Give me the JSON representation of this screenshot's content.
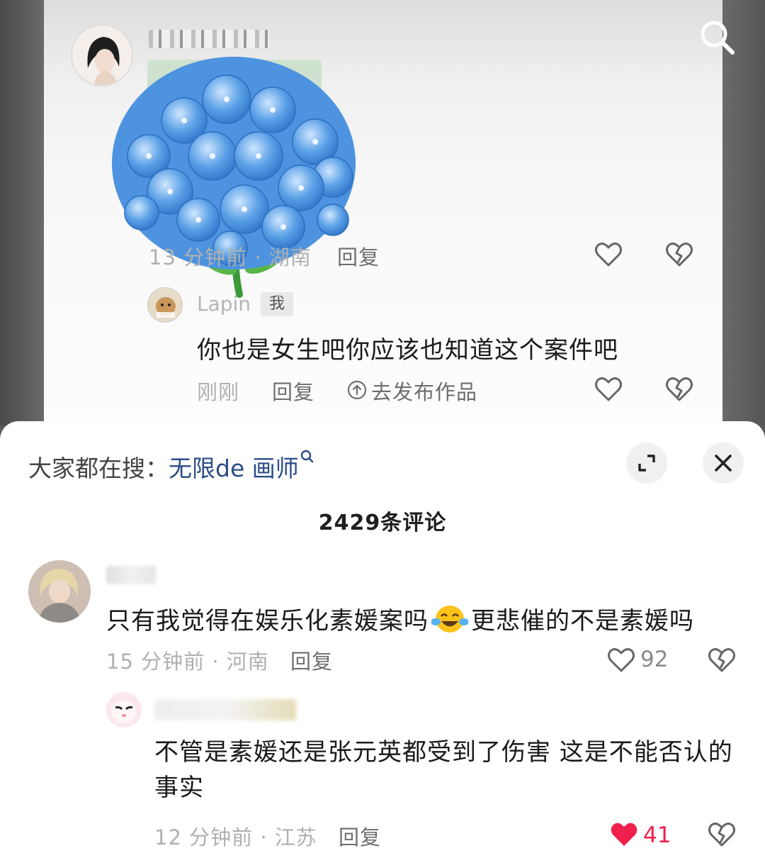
{
  "top_comment": {
    "time_location": "13 分钟前 · 湖南",
    "reply_label": "回复"
  },
  "my_reply": {
    "username": "Lapin",
    "badge": "我",
    "text": "你也是女生吧你应该也知道这个案件吧",
    "time": "刚刚",
    "reply_label": "回复",
    "publish_label": "去发布作品"
  },
  "sheet": {
    "hot_search_prefix": "大家都在搜：",
    "hot_search_keyword": "无限de 画师",
    "comment_count": "2429条评论"
  },
  "comment1": {
    "text_before_emoji": "只有我觉得在娱乐化素媛案吗",
    "emoji": "tears-of-joy-emoji",
    "text_after_emoji": "更悲催的不是素媛吗",
    "time_location": "15 分钟前 · 河南",
    "reply_label": "回复",
    "likes": "92"
  },
  "comment2": {
    "text": "不管是素媛还是张元英都受到了伤害 这是不能否认的事实",
    "time_location": "12 分钟前 · 江苏",
    "reply_label": "回复",
    "likes": "41",
    "liked": true
  },
  "icons": [
    "search-icon",
    "heart-icon",
    "dislike-icon",
    "expand-icon",
    "close-icon",
    "upload-icon"
  ],
  "colors": {
    "keyword": "#2a4d87",
    "liked_heart": "#f0204c",
    "balloon_blue": "#5aa0e6"
  }
}
